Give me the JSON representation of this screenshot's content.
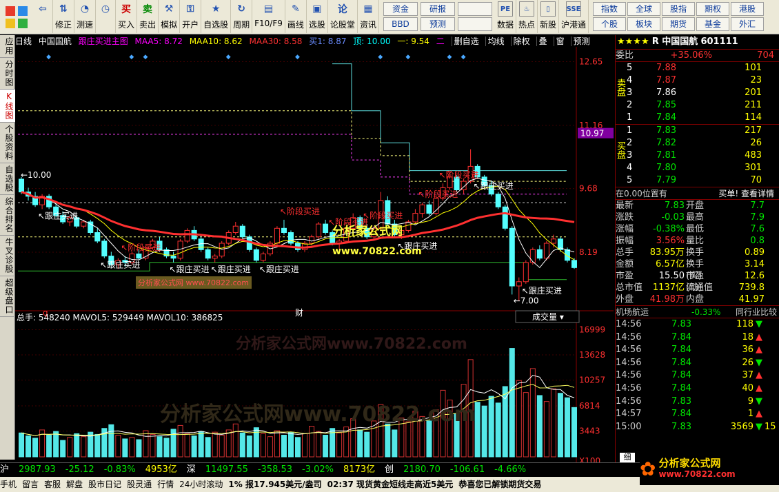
{
  "toolbar": {
    "buttons": [
      {
        "label": "",
        "icon": "back-arrow-icon",
        "sym": "⇦"
      },
      {
        "label": "修正",
        "icon": "up-down-arrow-icon",
        "sym": "⇅"
      },
      {
        "label": "测速",
        "icon": "speed-icon",
        "sym": "◔"
      },
      {
        "label": "",
        "icon": "clock-icon",
        "sym": "◷"
      },
      {
        "label": "买入",
        "icon": "buy-icon",
        "sym": "买"
      },
      {
        "label": "卖出",
        "icon": "sell-icon",
        "sym": "卖"
      },
      {
        "label": "模拟",
        "icon": "hammer-icon",
        "sym": "⚒"
      },
      {
        "label": "开户",
        "icon": "lock-icon",
        "sym": "⚿"
      },
      {
        "label": "自选股",
        "icon": "star-icon",
        "sym": "★"
      },
      {
        "label": "周期",
        "icon": "cycle-icon",
        "sym": "↻"
      },
      {
        "label": "F10/F9",
        "icon": "f10-icon",
        "sym": "▤"
      },
      {
        "label": "画线",
        "icon": "pencil-icon",
        "sym": "✎"
      },
      {
        "label": "选股",
        "icon": "screen-icon",
        "sym": "▣"
      },
      {
        "label": "论股堂",
        "icon": "forum-icon",
        "sym": "论"
      },
      {
        "label": "资讯",
        "icon": "news-icon",
        "sym": "▦"
      }
    ],
    "box_items": [
      "资金",
      "研报",
      "",
      "BBD",
      "预测",
      ""
    ],
    "right_buttons": [
      {
        "label": "数据",
        "sym": "PE"
      },
      {
        "label": "热点",
        "sym": "♨"
      },
      {
        "label": "新股",
        "sym": "▯"
      },
      {
        "label": "沪港通",
        "sym": "SSE"
      }
    ],
    "right_grid": [
      "指数",
      "全球",
      "股指",
      "期权",
      "港股",
      "个股",
      "板块",
      "期货",
      "基金",
      "外汇"
    ]
  },
  "left_tabs": [
    {
      "label": "应用",
      "active": false
    },
    {
      "label": "分时图",
      "active": false
    },
    {
      "label": "K线图",
      "active": true
    },
    {
      "label": "个股资料",
      "active": false
    },
    {
      "label": "自选股",
      "active": false
    },
    {
      "label": "综合排名",
      "active": false
    },
    {
      "label": "牛叉诊股",
      "active": false
    },
    {
      "label": "超级盘口",
      "active": false
    }
  ],
  "chart_info": {
    "period": "日线",
    "stock": "中国国航",
    "indicator": "跟庄买进主图",
    "maa5": "MAA5: 8.72",
    "maa10": "MAA10: 8.62",
    "maa30": "MAA30: 8.58",
    "buy1": "买1: 8.87",
    "top": "顶: 10.00",
    "one": "一: 9.54",
    "two": "二",
    "menu": [
      "删自选",
      "均线",
      "除权",
      "叠",
      "窗",
      "预测"
    ]
  },
  "chart_data": [
    {
      "type": "candlestick",
      "title": "跟庄买进主图",
      "ylim": [
        6.9,
        12.9
      ],
      "y_ticks": [
        12.65,
        11.16,
        9.68,
        8.19
      ],
      "current_price_tag": "10.97",
      "ohlc": [
        [
          9.9,
          9.95,
          9.55,
          9.6
        ],
        [
          9.6,
          9.7,
          9.4,
          9.5
        ],
        [
          9.5,
          9.6,
          9.25,
          9.3
        ],
        [
          9.3,
          9.55,
          9.2,
          9.5
        ],
        [
          9.5,
          9.55,
          9.2,
          9.25
        ],
        [
          9.25,
          9.35,
          9.0,
          9.05
        ],
        [
          9.05,
          9.15,
          8.85,
          8.9
        ],
        [
          8.9,
          9.05,
          8.8,
          9.0
        ],
        [
          9.0,
          9.05,
          8.75,
          8.8
        ],
        [
          8.8,
          8.95,
          8.75,
          8.9
        ],
        [
          8.9,
          8.95,
          8.6,
          8.65
        ],
        [
          8.65,
          8.75,
          8.4,
          8.45
        ],
        [
          8.45,
          8.5,
          8.05,
          8.1
        ],
        [
          8.1,
          8.2,
          7.85,
          7.9
        ],
        [
          7.9,
          8.05,
          7.8,
          8.0
        ],
        [
          8.0,
          8.1,
          7.85,
          7.95
        ],
        [
          7.95,
          8.2,
          7.9,
          8.15
        ],
        [
          8.15,
          8.25,
          8.0,
          8.05
        ],
        [
          8.05,
          8.35,
          8.0,
          8.3
        ],
        [
          8.3,
          8.5,
          8.25,
          8.45
        ],
        [
          8.45,
          8.55,
          8.2,
          8.25
        ],
        [
          8.25,
          8.3,
          8.05,
          8.1
        ],
        [
          8.1,
          8.2,
          7.95,
          8.05
        ],
        [
          8.05,
          8.5,
          8.0,
          8.45
        ],
        [
          8.45,
          8.75,
          8.4,
          8.7
        ],
        [
          8.7,
          8.8,
          8.45,
          8.5
        ],
        [
          8.5,
          8.6,
          8.2,
          8.25
        ],
        [
          8.25,
          8.3,
          8.0,
          8.05
        ],
        [
          8.05,
          8.15,
          7.95,
          8.1
        ],
        [
          8.1,
          8.45,
          8.05,
          8.4
        ],
        [
          8.4,
          8.7,
          8.35,
          8.65
        ],
        [
          8.65,
          8.9,
          8.6,
          8.8
        ],
        [
          8.8,
          8.85,
          8.5,
          8.55
        ],
        [
          8.55,
          8.6,
          8.2,
          8.25
        ],
        [
          8.25,
          8.3,
          7.95,
          8.0
        ],
        [
          8.0,
          8.2,
          7.95,
          8.15
        ],
        [
          8.15,
          8.45,
          8.1,
          8.4
        ],
        [
          8.4,
          8.8,
          8.35,
          8.75
        ],
        [
          8.75,
          8.95,
          8.6,
          8.65
        ],
        [
          8.65,
          8.7,
          8.35,
          8.4
        ],
        [
          8.4,
          8.45,
          8.2,
          8.25
        ],
        [
          8.25,
          8.45,
          8.2,
          8.4
        ],
        [
          8.4,
          8.6,
          8.35,
          8.55
        ],
        [
          8.55,
          8.9,
          8.5,
          8.85
        ],
        [
          8.85,
          8.95,
          8.6,
          8.65
        ],
        [
          8.65,
          8.7,
          8.35,
          8.4
        ],
        [
          8.4,
          8.5,
          8.25,
          8.45
        ],
        [
          8.45,
          8.8,
          8.4,
          8.75
        ],
        [
          8.75,
          9.1,
          8.7,
          9.0
        ],
        [
          9.0,
          9.05,
          8.7,
          8.75
        ],
        [
          8.75,
          8.85,
          8.5,
          8.55
        ],
        [
          8.55,
          8.8,
          8.5,
          8.75
        ],
        [
          8.75,
          9.6,
          8.7,
          9.4
        ],
        [
          9.4,
          9.5,
          8.8,
          8.85
        ],
        [
          8.85,
          8.95,
          8.55,
          8.6
        ],
        [
          8.6,
          8.75,
          8.5,
          8.7
        ],
        [
          8.7,
          8.95,
          8.65,
          8.9
        ],
        [
          8.9,
          9.2,
          8.85,
          9.1
        ],
        [
          9.1,
          9.35,
          9.0,
          9.3
        ],
        [
          9.3,
          9.4,
          9.05,
          9.1
        ],
        [
          9.1,
          9.5,
          9.05,
          9.45
        ],
        [
          9.45,
          9.8,
          9.4,
          9.7
        ],
        [
          9.7,
          10.1,
          9.65,
          9.95
        ],
        [
          9.95,
          10.0,
          9.6,
          9.65
        ],
        [
          9.65,
          9.9,
          9.55,
          9.85
        ],
        [
          9.85,
          10.6,
          9.8,
          10.2
        ],
        [
          10.2,
          10.25,
          9.9,
          9.95
        ],
        [
          9.95,
          10.0,
          9.7,
          9.75
        ],
        [
          9.75,
          9.85,
          9.5,
          9.55
        ],
        [
          9.55,
          9.6,
          9.2,
          9.25
        ],
        [
          9.25,
          9.3,
          8.7,
          8.75
        ],
        [
          8.75,
          8.8,
          7.2,
          7.4
        ],
        [
          7.4,
          7.6,
          7.05,
          7.5
        ],
        [
          7.5,
          8.0,
          7.45,
          7.95
        ],
        [
          7.95,
          8.3,
          7.9,
          8.25
        ],
        [
          8.25,
          8.35,
          8.0,
          8.05
        ],
        [
          8.05,
          8.45,
          8.0,
          8.4
        ],
        [
          8.4,
          8.6,
          8.3,
          8.5
        ],
        [
          8.5,
          8.55,
          8.2,
          8.25
        ],
        [
          8.25,
          8.3,
          7.95,
          8.0
        ],
        [
          8.0,
          8.05,
          7.8,
          7.83
        ]
      ],
      "ma_series": [
        {
          "name": "MAA5",
          "color": "#ffffff",
          "value": "8.72"
        },
        {
          "name": "MAA10",
          "color": "#ffff00",
          "value": "8.62"
        },
        {
          "name": "MAA30",
          "color": "#ff3030",
          "value": "8.58"
        }
      ],
      "annotations": [
        "跟庄买进",
        "阶段买进",
        "10.00",
        "7.00",
        "财",
        "q"
      ],
      "watermark": [
        "分析家公式网",
        "www.70822.com"
      ]
    },
    {
      "type": "bar",
      "title": "成交量",
      "series_label": "总手: 548240",
      "mavol5": "MAVOL5: 529449",
      "mavol10": "MAVOL10: 386825",
      "y_ticks": [
        "16999",
        "13628",
        "10257",
        "6814",
        "3443",
        "X100"
      ],
      "ylim": [
        0,
        17500
      ],
      "values": [
        3200,
        2800,
        2500,
        3600,
        2900,
        3400,
        2200,
        2600,
        3100,
        2700,
        3300,
        3000,
        3800,
        4300,
        2900,
        2400,
        2600,
        2300,
        3500,
        3000,
        2700,
        2500,
        3700,
        4200,
        3100,
        2800,
        3400,
        2600,
        3300,
        2900,
        3600,
        4400,
        3200,
        2800,
        3900,
        3100,
        2700,
        3500,
        2900,
        3300,
        2600,
        3100,
        4100,
        3400,
        2900,
        3800,
        3200,
        4000,
        5100,
        3600,
        3300,
        4800,
        7000,
        4400,
        3600,
        5200,
        4700,
        6100,
        5400,
        4800,
        6300,
        8900,
        7600,
        5800,
        9700,
        13000,
        7300,
        6800,
        8100,
        7200,
        9400,
        14500,
        10200,
        8600,
        11800,
        8200,
        7400,
        9100,
        8500,
        7900,
        6600
      ]
    }
  ],
  "order_book": {
    "title": "R 中国国航",
    "code": "601111",
    "weibi_label": "委比",
    "weibi": "+35.06%",
    "weibi_val": "704",
    "sell_label": "卖盘",
    "buy_label": "买盘",
    "sell": [
      {
        "lv": "5",
        "p": "7.88",
        "v": "101"
      },
      {
        "lv": "4",
        "p": "7.87",
        "v": "23"
      },
      {
        "lv": "3",
        "p": "7.86",
        "v": "201"
      },
      {
        "lv": "2",
        "p": "7.85",
        "v": "211"
      },
      {
        "lv": "1",
        "p": "7.84",
        "v": "114"
      }
    ],
    "buy": [
      {
        "lv": "1",
        "p": "7.83",
        "v": "217"
      },
      {
        "lv": "2",
        "p": "7.82",
        "v": "26"
      },
      {
        "lv": "3",
        "p": "7.81",
        "v": "483"
      },
      {
        "lv": "4",
        "p": "7.80",
        "v": "301"
      },
      {
        "lv": "5",
        "p": "7.79",
        "v": "70"
      }
    ],
    "pos_text": "在0.00位置有",
    "pos_link": "买单! 查看详情"
  },
  "quotes": [
    {
      "k": "最新",
      "v": "7.83",
      "k2": "开盘",
      "v2": "7.7"
    },
    {
      "k": "涨跌",
      "v": "-0.03",
      "k2": "最高",
      "v2": "7.9"
    },
    {
      "k": "涨幅",
      "v": "-0.38%",
      "k2": "最低",
      "v2": "7.6"
    },
    {
      "k": "振幅",
      "v": "3.56%",
      "k2": "量比",
      "v2": "0.8"
    },
    {
      "k": "总手",
      "v": "83.95万",
      "k2": "换手",
      "v2": "0.89"
    },
    {
      "k": "金额",
      "v": "6.57亿",
      "k2": "换手(实)",
      "v2": "3.14"
    },
    {
      "k": "市盈",
      "v": "15.50",
      "k2": "市盈(动)",
      "v2": "12.6"
    },
    {
      "k": "总市值",
      "v": "1137亿",
      "k2": "流通值",
      "v2": "739.8"
    },
    {
      "k": "外盘",
      "v": "41.98万",
      "k2": "内盘",
      "v2": "41.97"
    }
  ],
  "sector": {
    "name": "机场航运",
    "change": "-0.33%",
    "link": "同行业比较"
  },
  "ticks": [
    {
      "t": "14:56",
      "p": "7.83",
      "v": "118",
      "dir": "down"
    },
    {
      "t": "14:56",
      "p": "7.84",
      "v": "18",
      "dir": "up"
    },
    {
      "t": "14:56",
      "p": "7.84",
      "v": "36",
      "dir": "up"
    },
    {
      "t": "14:56",
      "p": "7.84",
      "v": "26",
      "dir": "down"
    },
    {
      "t": "14:56",
      "p": "7.84",
      "v": "37",
      "dir": "up"
    },
    {
      "t": "14:56",
      "p": "7.84",
      "v": "40",
      "dir": "up"
    },
    {
      "t": "14:56",
      "p": "7.83",
      "v": "9",
      "dir": "down"
    },
    {
      "t": "14:57",
      "p": "7.84",
      "v": "1",
      "dir": "up"
    },
    {
      "t": "15:00",
      "p": "7.83",
      "v": "3569",
      "dir": "down",
      "tail": "15"
    }
  ],
  "bottom_tab": "细",
  "indices": [
    {
      "t": "沪",
      "c": "#ffffff"
    },
    {
      "t": "2987.93",
      "c": "#00e600"
    },
    {
      "t": "-25.12",
      "c": "#00e600"
    },
    {
      "t": "-0.83%",
      "c": "#00e600"
    },
    {
      "t": "4953亿",
      "c": "#ffff00"
    },
    {
      "t": "深",
      "c": "#ffffff"
    },
    {
      "t": "11497.55",
      "c": "#00e600"
    },
    {
      "t": "-358.53",
      "c": "#00e600"
    },
    {
      "t": "-3.02%",
      "c": "#00e600"
    },
    {
      "t": "8173亿",
      "c": "#ffff00"
    },
    {
      "t": "创",
      "c": "#ffffff"
    },
    {
      "t": "2180.70",
      "c": "#00e600"
    },
    {
      "t": "-106.61",
      "c": "#00e600"
    },
    {
      "t": "-4.66%",
      "c": "#00e600"
    }
  ],
  "status_bar": [
    "手机",
    "留言",
    "客服",
    "解盘",
    "股市日记",
    "股灵通",
    "行情",
    "24小时滚动",
    "1% 报17.945美元/盎司",
    "02:37 现货黄金短线走高近5美元",
    "恭喜您已解锁期货交易"
  ],
  "logo_text": "分析家公式网",
  "logo_url": "www.70822.com"
}
